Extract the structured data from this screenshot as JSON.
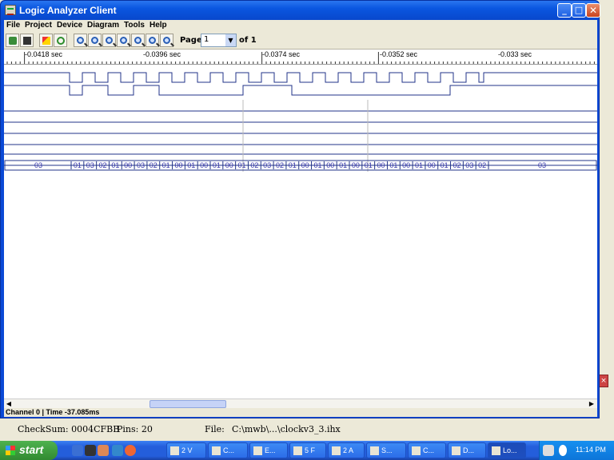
{
  "window": {
    "title": "Logic Analyzer Client"
  },
  "menu": [
    "File",
    "Project",
    "Device",
    "Diagram",
    "Tools",
    "Help"
  ],
  "toolbar": {
    "buttons": [
      "open-icon",
      "save-icon",
      "rocket-icon",
      "refresh-icon",
      "zoom-icon",
      "zoom-icon",
      "zoom-icon",
      "zoom-icon",
      "zoom-icon",
      "zoom-icon",
      "zoom-icon"
    ],
    "page_label": "Page",
    "page_value": "1",
    "page_of": "of 1"
  },
  "timeline": {
    "labels": [
      "-0.0418 sec",
      "-0.0396 sec",
      "-0.0374 sec",
      "-0.0352 sec",
      "-0.033 sec"
    ]
  },
  "bus": {
    "values": [
      "03",
      "01",
      "03",
      "02",
      "01",
      "00",
      "03",
      "02",
      "01",
      "00",
      "01",
      "00",
      "01",
      "00",
      "01",
      "02",
      "03",
      "02",
      "01",
      "00",
      "01",
      "00",
      "01",
      "00",
      "01",
      "00",
      "01",
      "00",
      "01",
      "00",
      "01",
      "02",
      "03",
      "02",
      "03"
    ]
  },
  "status": {
    "text": "Channel 0 | Time -37.085ms"
  },
  "background_status": {
    "checksum": "CheckSum: 0004CFBB",
    "pins": "Pins:  20",
    "file_label": "File:",
    "file_path": "C:\\mwb\\...\\clockv3_3.ihx"
  },
  "taskbar": {
    "start": "start",
    "tasks": [
      "2 V",
      "C...",
      "E...",
      "5 F",
      "2 A",
      "S...",
      "C...",
      "D...",
      "Lo..."
    ],
    "clock": "11:14 PM"
  }
}
